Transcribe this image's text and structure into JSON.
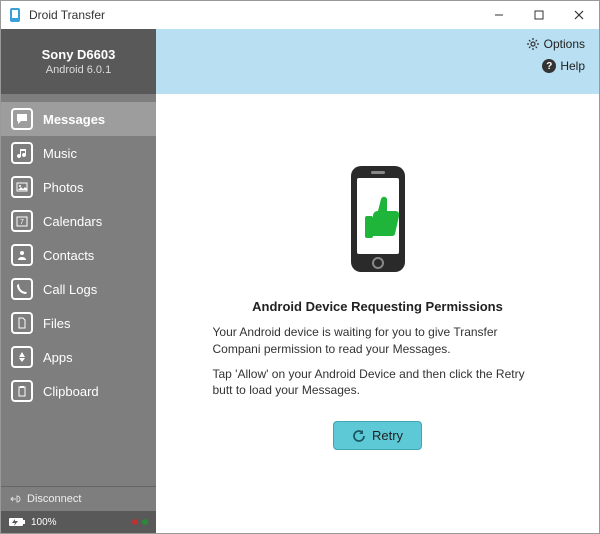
{
  "window": {
    "title": "Droid Transfer"
  },
  "device": {
    "name": "Sony D6603",
    "os": "Android 6.0.1"
  },
  "sidebar": {
    "items": [
      {
        "label": "Messages",
        "icon": "message-icon",
        "active": true
      },
      {
        "label": "Music",
        "icon": "music-icon",
        "active": false
      },
      {
        "label": "Photos",
        "icon": "photo-icon",
        "active": false
      },
      {
        "label": "Calendars",
        "icon": "calendar-icon",
        "active": false
      },
      {
        "label": "Contacts",
        "icon": "contacts-icon",
        "active": false
      },
      {
        "label": "Call Logs",
        "icon": "phone-icon",
        "active": false
      },
      {
        "label": "Files",
        "icon": "files-icon",
        "active": false
      },
      {
        "label": "Apps",
        "icon": "apps-icon",
        "active": false
      },
      {
        "label": "Clipboard",
        "icon": "clipboard-icon",
        "active": false
      }
    ],
    "disconnect": "Disconnect",
    "battery": "100%"
  },
  "topbar": {
    "options": "Options",
    "help": "Help"
  },
  "content": {
    "title": "Android Device Requesting Permissions",
    "line1": "Your Android device is waiting for you to give Transfer Compani permission to read your Messages.",
    "line2": "Tap 'Allow' on your Android Device and then click the Retry butt to load your Messages.",
    "retry": "Retry"
  },
  "status_dots": [
    "#d44",
    "#2a8"
  ]
}
